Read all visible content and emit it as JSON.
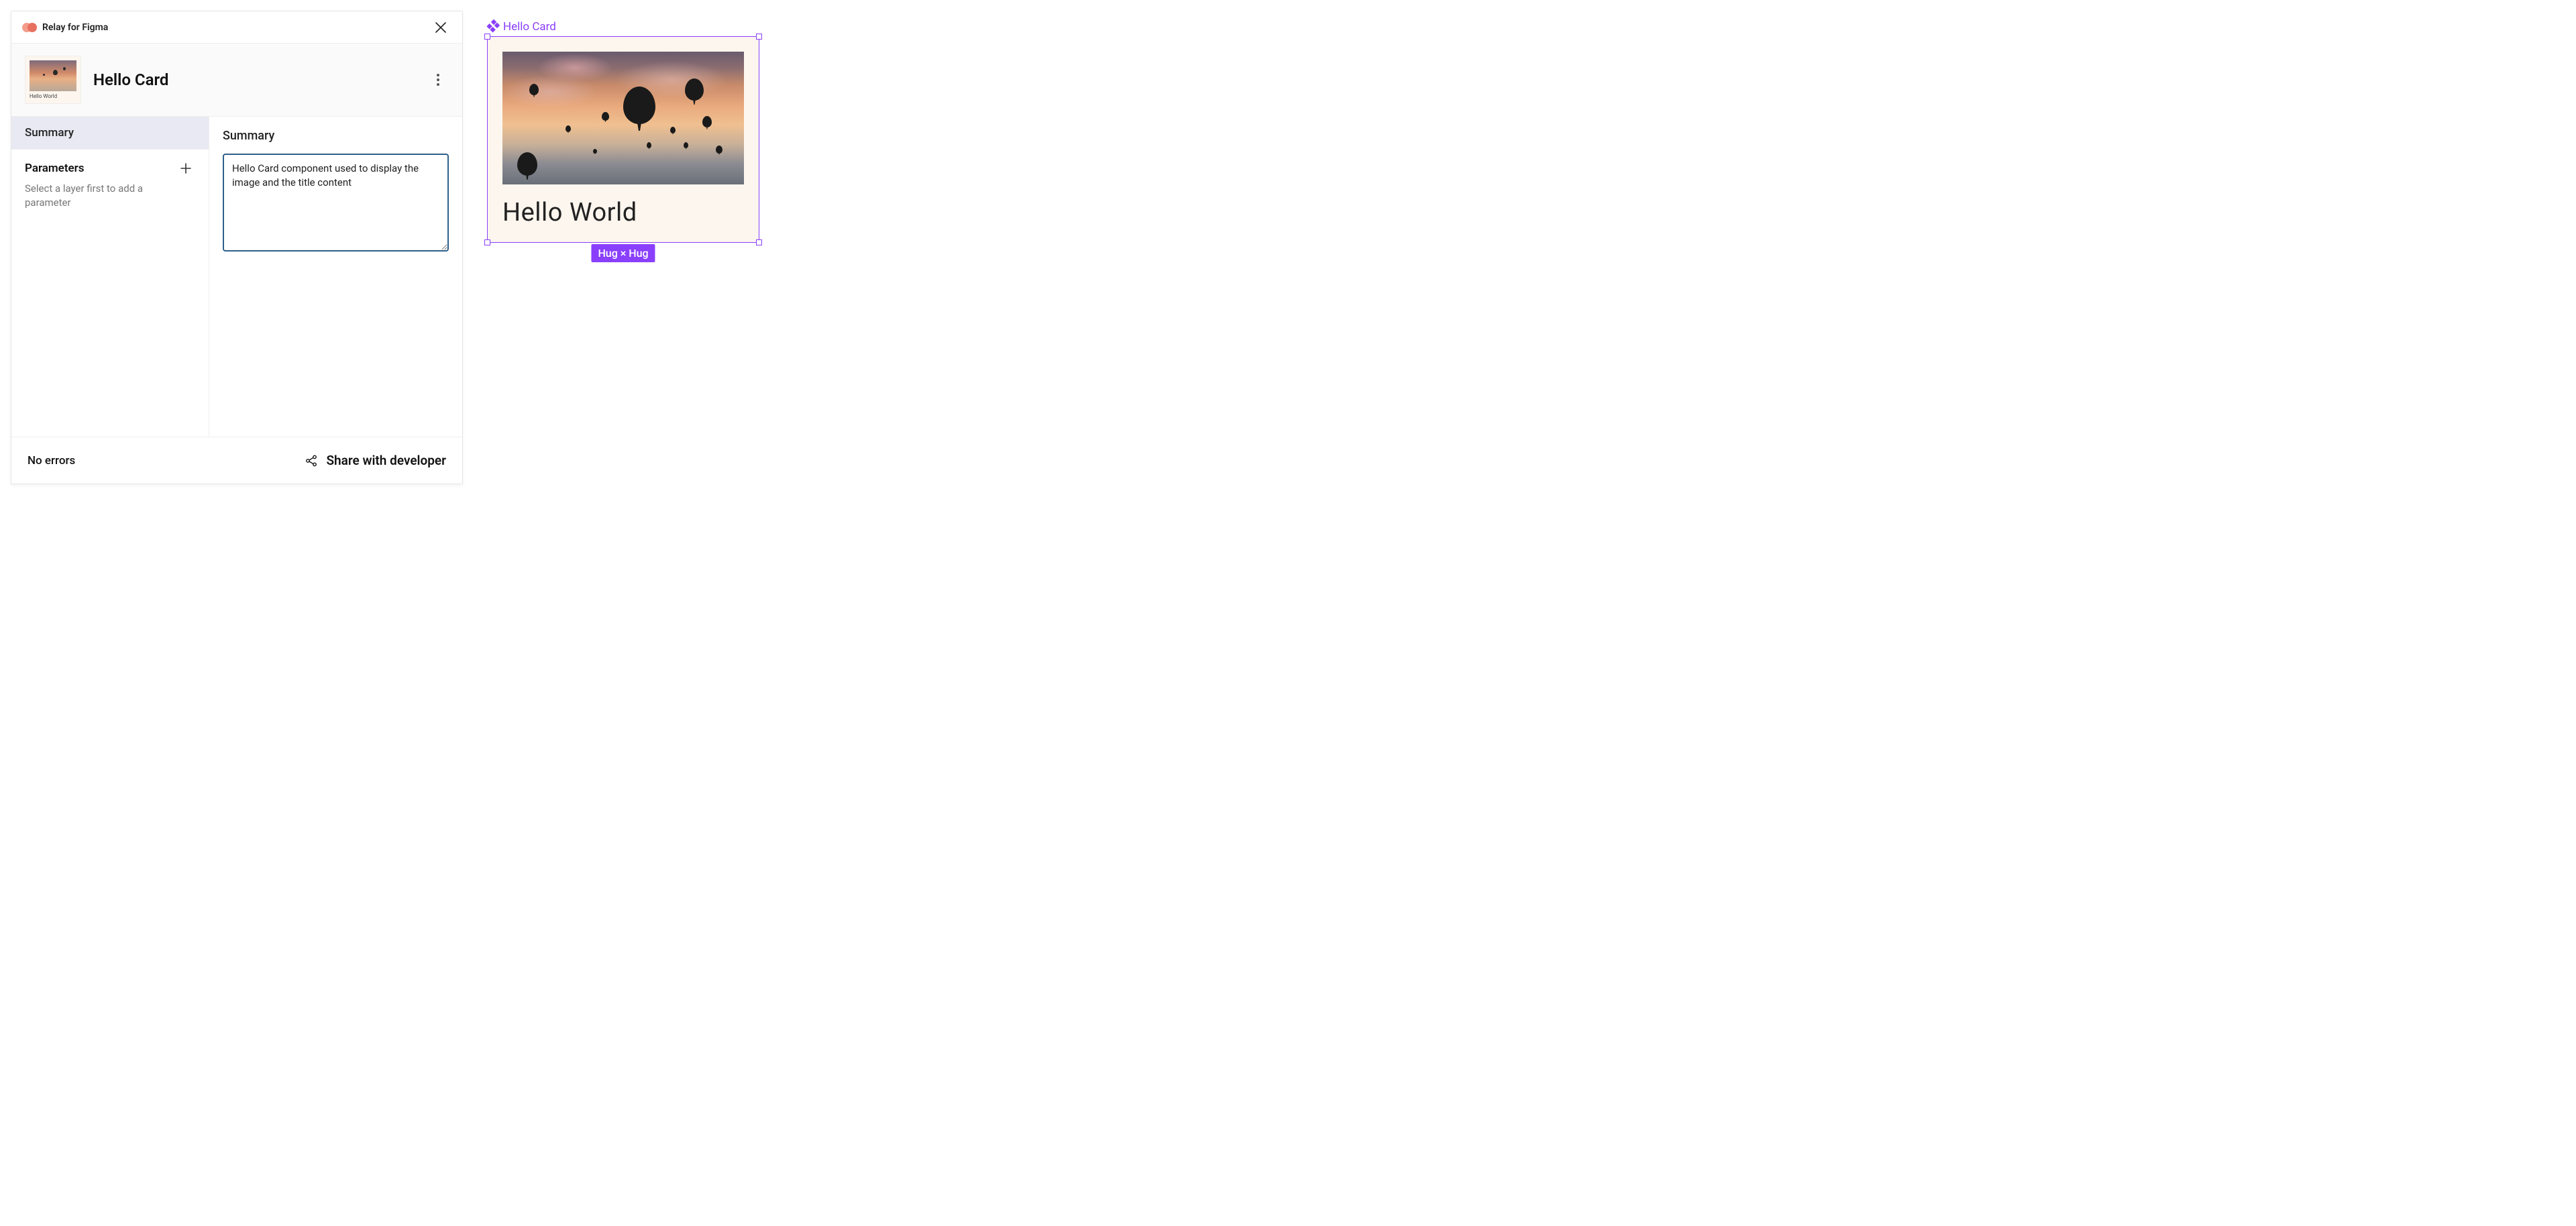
{
  "panel": {
    "title": "Relay for Figma"
  },
  "component": {
    "name": "Hello Card",
    "thumb_caption": "Hello World"
  },
  "sidebar": {
    "tabs": {
      "summary": "Summary"
    },
    "params": {
      "title": "Parameters",
      "hint": "Select a layer first to add a parameter"
    }
  },
  "main": {
    "heading": "Summary",
    "summary_value": "Hello Card component used to display the image and the title content"
  },
  "footer": {
    "status": "No errors",
    "share_label": "Share with developer"
  },
  "canvas": {
    "label": "Hello Card",
    "card_title": "Hello World",
    "size_badge": "Hug × Hug"
  }
}
